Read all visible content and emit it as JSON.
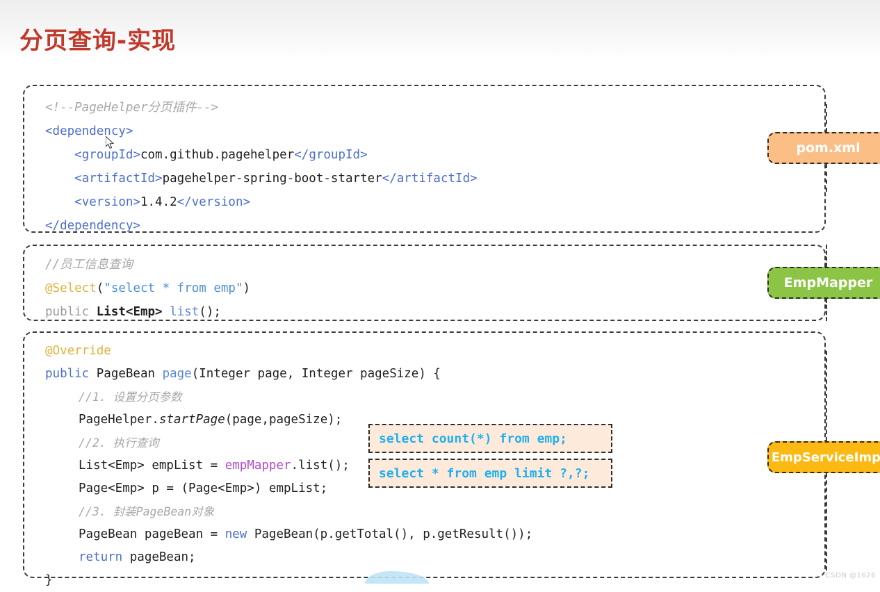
{
  "page": {
    "title": "分页查询-实现",
    "watermark": "CSDN @1626",
    "title_color": "#c0392b"
  },
  "panels": [
    {
      "id": "pom",
      "badge": {
        "label": "pom.xml",
        "color": "#FBBE84"
      },
      "lines": [
        {
          "comment": "<!--PageHelper分页插件-->"
        },
        {
          "tag_open": "<dependency>"
        },
        {
          "tag_open": "<groupId>",
          "text": "com.github.pagehelper",
          "tag_close": "</groupId>"
        },
        {
          "tag_open": "<artifactId>",
          "text": "pagehelper-spring-boot-starter",
          "tag_close": "</artifactId>"
        },
        {
          "tag_open": "<version>",
          "text": "1.4.2",
          "tag_close": "</version>"
        },
        {
          "tag_open": "</dependency>"
        }
      ]
    },
    {
      "id": "mapper",
      "badge": {
        "label": "EmpMapper",
        "color": "#8CC445"
      },
      "lines": {
        "comment": "//员工信息查询",
        "annotation": "@Select",
        "paren_open": "(",
        "string": "\"select * from emp\"",
        "paren_close": ")",
        "modifier": "public ",
        "type": "List<Emp>",
        "space": " ",
        "method": "list",
        "tail": "();"
      }
    },
    {
      "id": "service",
      "badge": {
        "label": "EmpServiceImpl",
        "color": "#FDB913"
      },
      "lines": {
        "override": "@Override",
        "sig_kw": "public",
        "sig_type": " PageBean ",
        "sig_name": "page",
        "sig_params": "(Integer page, Integer pageSize) {",
        "c1": "//1. 设置分页参数",
        "s1_a": "PageHelper.",
        "s1_b": "startPage",
        "s1_c": "(page,pageSize);",
        "c2": "//2. 执行查询",
        "s2_a": "List<Emp> empList = ",
        "s2_b": "empMapper",
        "s2_c": ".list();",
        "s3": "Page<Emp> p = (Page<Emp>) empList;",
        "c3": "//3. 封装PageBean对象",
        "s4_a": "PageBean pageBean = ",
        "s4_b": "new",
        "s4_c": " PageBean(p.getTotal(), p.getResult());",
        "s5_a": "return",
        "s5_b": " pageBean;",
        "close": "}"
      }
    }
  ],
  "sql_callouts": [
    {
      "id": "count",
      "sql": "select count(*) from emp;"
    },
    {
      "id": "limit",
      "sql": "select * from emp limit ?,?;"
    }
  ]
}
